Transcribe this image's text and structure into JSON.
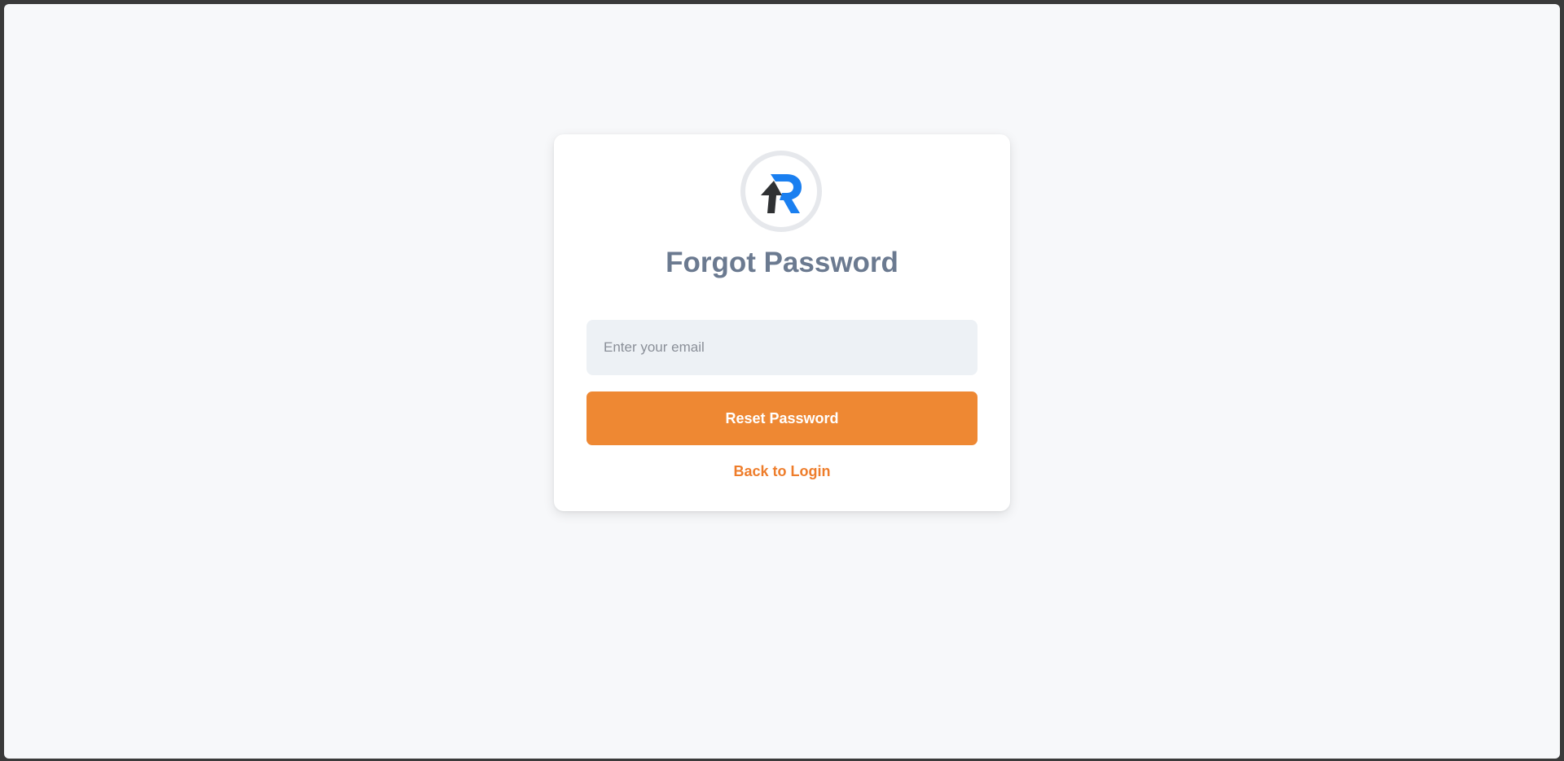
{
  "logo": {
    "icon": "r-arrow-logo-icon",
    "colors": {
      "ring": "#e6e8ec",
      "letter": "#1a7ff0",
      "arrow": "#2f3133"
    }
  },
  "form": {
    "title": "Forgot Password",
    "email_placeholder": "Enter your email",
    "email_value": "",
    "submit_label": "Reset Password",
    "back_link_label": "Back to Login"
  },
  "colors": {
    "accent": "#ee8833",
    "title": "#6b7a90",
    "background": "#f7f8fa"
  }
}
